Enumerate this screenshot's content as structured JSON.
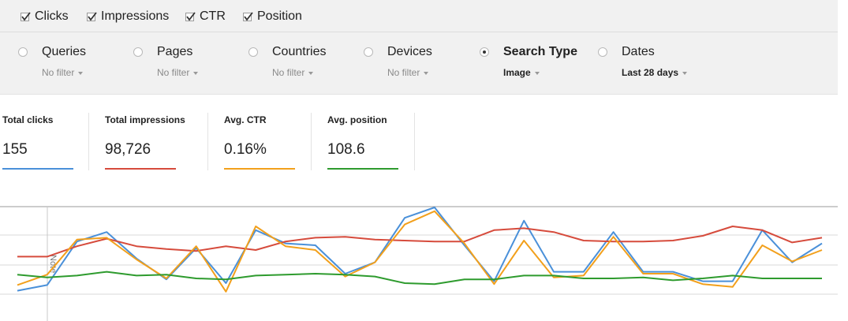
{
  "metrics": [
    {
      "label": "Clicks",
      "checked": true
    },
    {
      "label": "Impressions",
      "checked": true
    },
    {
      "label": "CTR",
      "checked": true
    },
    {
      "label": "Position",
      "checked": true
    }
  ],
  "dimensions": [
    {
      "label": "Queries",
      "filter": "No filter",
      "selected": false
    },
    {
      "label": "Pages",
      "filter": "No filter",
      "selected": false
    },
    {
      "label": "Countries",
      "filter": "No filter",
      "selected": false
    },
    {
      "label": "Devices",
      "filter": "No filter",
      "selected": false
    },
    {
      "label": "Search Type",
      "filter": "Image",
      "selected": true
    },
    {
      "label": "Dates",
      "filter": "Last 28 days",
      "selected": false
    }
  ],
  "summary": [
    {
      "label": "Total clicks",
      "value": "155",
      "color": "#4a90d9"
    },
    {
      "label": "Total impressions",
      "value": "98,726",
      "color": "#d64b3c"
    },
    {
      "label": "Avg. CTR",
      "value": "0.16%",
      "color": "#f2a01c"
    },
    {
      "label": "Avg. position",
      "value": "108.6",
      "color": "#2e9b2e"
    }
  ],
  "chart_data": {
    "type": "line",
    "note_label": "Note",
    "note_index": 1,
    "grid": true,
    "series": [
      {
        "metric": "clicks",
        "color": "#4a90d9",
        "values": [
          12,
          18,
          64,
          74,
          46,
          24,
          57,
          20,
          76,
          62,
          60,
          30,
          42,
          89,
          100,
          60,
          22,
          86,
          32,
          32,
          74,
          32,
          32,
          22,
          22,
          76,
          42,
          62
        ]
      },
      {
        "metric": "impressions",
        "color": "#d64b3c",
        "values": [
          48,
          48,
          59,
          67,
          59,
          56,
          54,
          59,
          55,
          64,
          68,
          69,
          66,
          65,
          64,
          64,
          76,
          78,
          74,
          65,
          64,
          64,
          65,
          70,
          80,
          76,
          63,
          68
        ]
      },
      {
        "metric": "ctr",
        "color": "#f2a01c",
        "values": [
          18,
          29,
          66,
          68,
          45,
          25,
          59,
          11,
          80,
          59,
          55,
          27,
          42,
          82,
          96,
          62,
          19,
          65,
          26,
          28,
          69,
          30,
          30,
          19,
          16,
          60,
          43,
          55
        ]
      },
      {
        "metric": "position",
        "color": "#2e9b2e",
        "values": [
          29,
          26,
          28,
          32,
          28,
          29,
          25,
          24,
          28,
          29,
          30,
          29,
          27,
          20,
          19,
          24,
          24,
          28,
          28,
          25,
          25,
          26,
          23,
          25,
          28,
          25,
          25,
          25
        ]
      }
    ]
  }
}
